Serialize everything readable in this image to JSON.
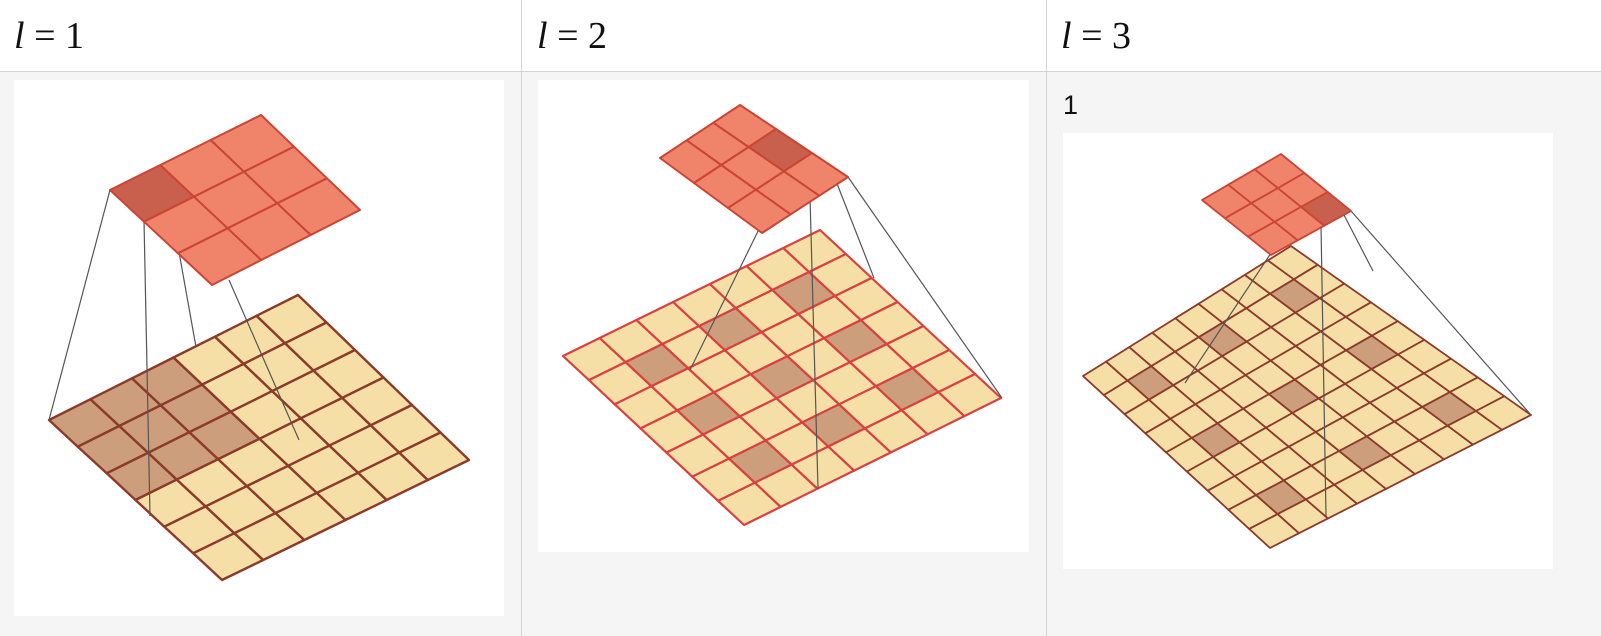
{
  "columns": [
    {
      "variable": "l",
      "equals": "=",
      "value": "1",
      "note": ""
    },
    {
      "variable": "l",
      "equals": "=",
      "value": "2",
      "note": ""
    },
    {
      "variable": "l",
      "equals": "=",
      "value": "3",
      "note": "1"
    }
  ],
  "diagram": {
    "kernel_size": 3,
    "input_size": 7,
    "dilations": [
      1,
      2,
      3
    ],
    "colors": {
      "kernel_fill": "#f0846a",
      "kernel_line": "#cc4433",
      "kernel_active": "#c95f4d",
      "input_fill": "#f5dfa6",
      "input_line_l1": "#8c3a2a",
      "input_line_l2": "#d94040",
      "input_line_l3": "#8c3a2a",
      "input_active": "#cd9e7c",
      "connector": "#555555",
      "panel": "#ffffff",
      "page": "#f5f5f5"
    }
  }
}
